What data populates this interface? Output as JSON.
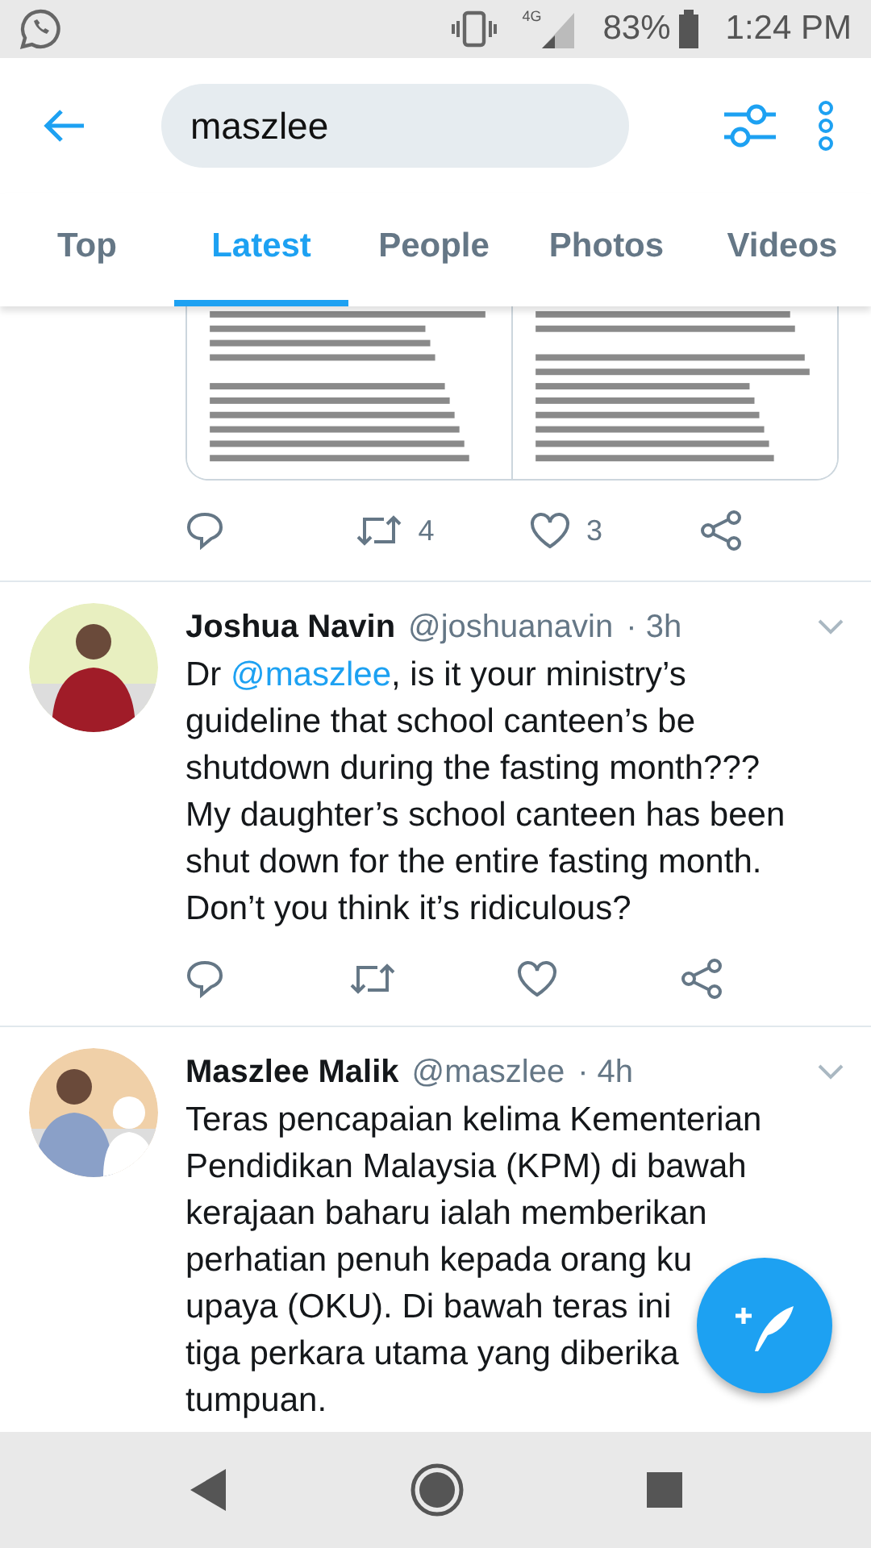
{
  "status_bar": {
    "network": "4G",
    "battery": "83%",
    "time": "1:24 PM"
  },
  "search": {
    "value": "maszlee"
  },
  "tabs": [
    {
      "label": "Top",
      "selected": false
    },
    {
      "label": "Latest",
      "selected": true
    },
    {
      "label": "People",
      "selected": false
    },
    {
      "label": "Photos",
      "selected": false
    },
    {
      "label": "Videos",
      "selected": false
    }
  ],
  "tweets": [
    {
      "kind": "media",
      "media": [
        {
          "kind": "picture"
        },
        {
          "kind": "picture"
        }
      ],
      "retweets": "4",
      "likes": "3"
    },
    {
      "kind": "text",
      "avatar": {
        "kind": "picture"
      },
      "name": "Joshua Navin",
      "handle": "@joshuanavin",
      "time": "· 3h",
      "lines": [
        [
          {
            "kind": "text",
            "text": "Dr "
          },
          {
            "kind": "mention",
            "text": "@maszlee"
          },
          {
            "kind": "text",
            "text": ", is it your ministry’s"
          }
        ],
        [
          {
            "kind": "text",
            "text": "guideline that school canteen’s be"
          }
        ],
        [
          {
            "kind": "text",
            "text": "shutdown during the fasting month???"
          }
        ],
        [
          {
            "kind": "text",
            "text": "My daughter’s school canteen has been"
          }
        ],
        [
          {
            "kind": "text",
            "text": "shut down for the entire fasting month."
          }
        ],
        [
          {
            "kind": "text",
            "text": "Don’t you think it’s ridiculous?"
          }
        ]
      ],
      "actions": true
    },
    {
      "kind": "text",
      "avatar": {
        "kind": "picture"
      },
      "name": "Maszlee Malik",
      "handle": "@maszlee",
      "time": "· 4h",
      "lines": [
        [
          {
            "kind": "text",
            "text": "Teras pencapaian kelima Kementerian"
          }
        ],
        [
          {
            "kind": "text",
            "text": "Pendidikan Malaysia (KPM) di bawah"
          }
        ],
        [
          {
            "kind": "text",
            "text": "kerajaan baharu ialah memberikan"
          }
        ],
        [
          {
            "kind": "text",
            "text": "perhatian penuh kepada orang ku"
          }
        ],
        [
          {
            "kind": "text",
            "text": "upaya (OKU). Di bawah teras ini"
          }
        ],
        [
          {
            "kind": "text",
            "text": "tiga perkara utama yang diberika"
          }
        ],
        [
          {
            "kind": "text",
            "text": "tumpuan."
          }
        ]
      ]
    }
  ]
}
